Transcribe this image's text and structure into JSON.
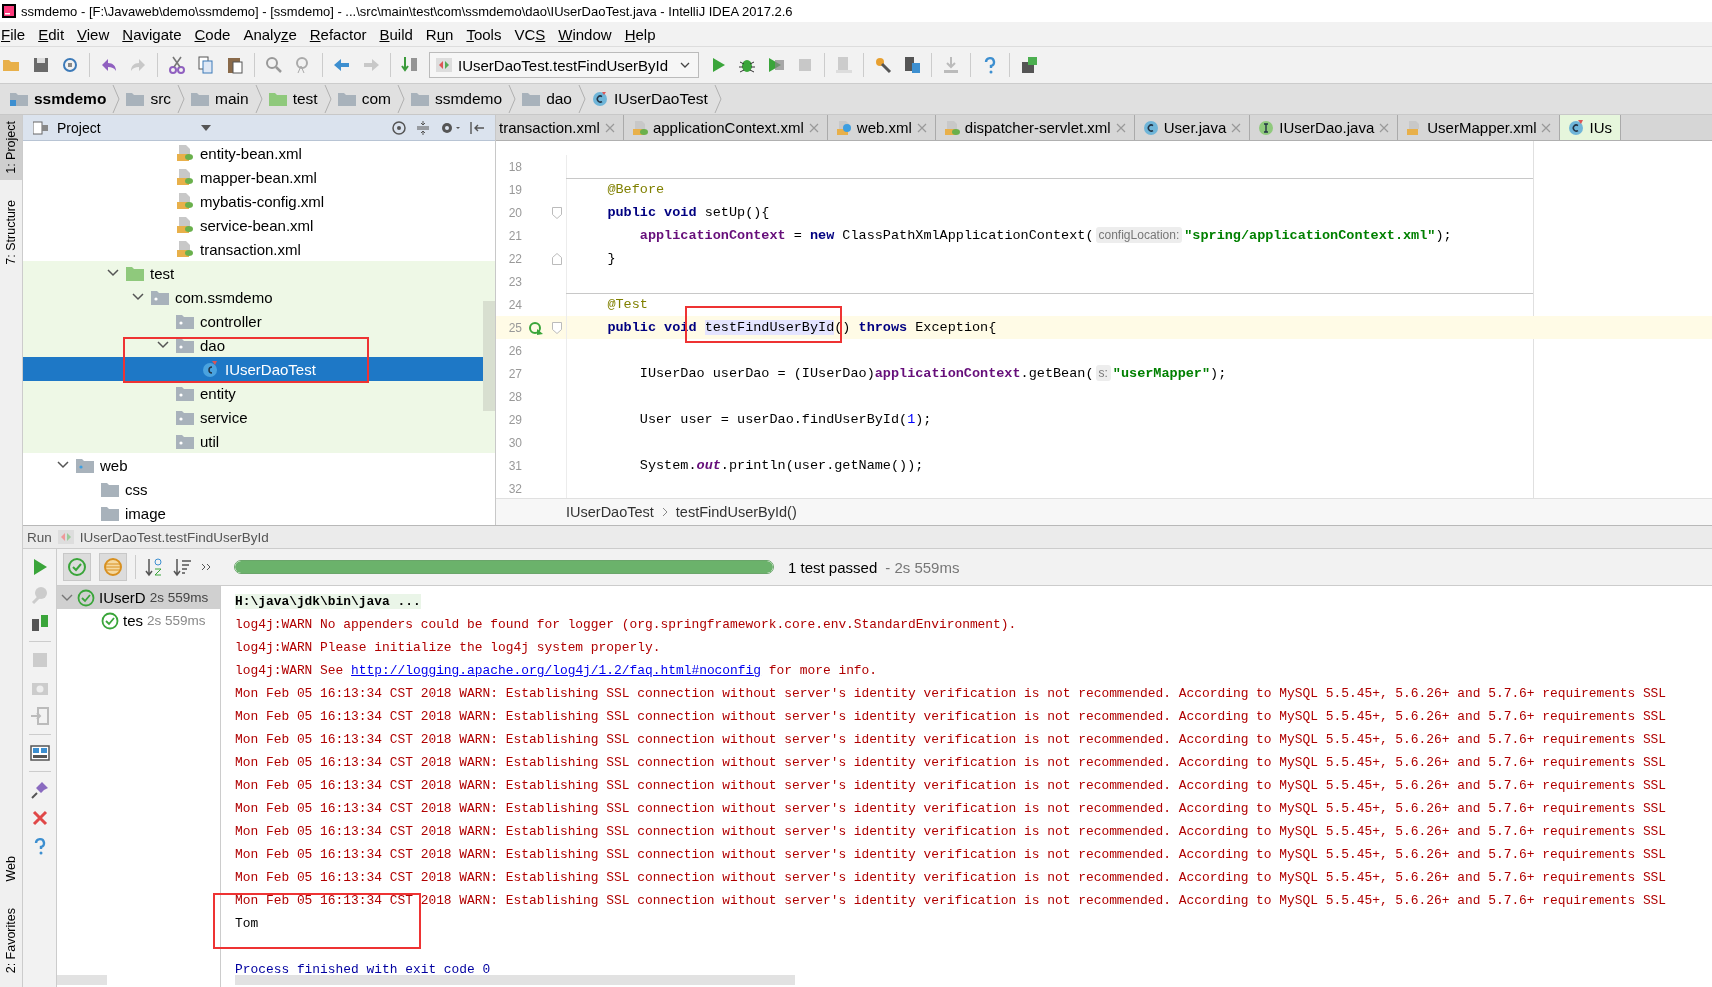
{
  "window": {
    "title": "ssmdemo - [F:\\Javaweb\\demo\\ssmdemo] - [ssmdemo] - ...\\src\\main\\test\\com\\ssmdemo\\dao\\IUserDaoTest.java - IntelliJ IDEA 2017.2.6"
  },
  "menu": [
    {
      "key": "F",
      "rest": "ile"
    },
    {
      "key": "E",
      "rest": "dit"
    },
    {
      "key": "V",
      "rest": "iew"
    },
    {
      "key": "N",
      "rest": "avigate"
    },
    {
      "key": "C",
      "rest": "ode"
    },
    {
      "lead": "Analy",
      "key": "z",
      "rest": "e"
    },
    {
      "key": "R",
      "rest": "efactor"
    },
    {
      "key": "B",
      "rest": "uild"
    },
    {
      "lead": "R",
      "key": "u",
      "rest": "n"
    },
    {
      "key": "T",
      "rest": "ools"
    },
    {
      "lead": "VC",
      "key": "S"
    },
    {
      "key": "W",
      "rest": "indow"
    },
    {
      "key": "H",
      "rest": "elp"
    }
  ],
  "toolbar": {
    "run_config": "IUserDaoTest.testFindUserById"
  },
  "breadcrumbs": [
    {
      "label": "ssmdemo",
      "kind": "module"
    },
    {
      "label": "src",
      "kind": "folder"
    },
    {
      "label": "main",
      "kind": "folder"
    },
    {
      "label": "test",
      "kind": "test_folder"
    },
    {
      "label": "com",
      "kind": "package"
    },
    {
      "label": "ssmdemo",
      "kind": "package"
    },
    {
      "label": "dao",
      "kind": "package"
    },
    {
      "label": "IUserDaoTest",
      "kind": "test_class"
    }
  ],
  "tool_strip": {
    "top": [
      {
        "label": "1: Project",
        "selected": true
      },
      {
        "label": "7: Structure",
        "selected": false
      }
    ],
    "bottom": [
      {
        "label": "Web",
        "selected": false
      },
      {
        "label": "2: Favorites",
        "selected": false
      }
    ]
  },
  "project_panel": {
    "title": "Project"
  },
  "tree": [
    {
      "children": [
        {
          "children": [
            {
              "children": [
                {
                  "children": [
                    {
                      "children": [
                        {
                          "label": "entity-bean.xml",
                          "kind": "xml",
                          "selected": false
                        },
                        {
                          "label": "mapper-bean.xml",
                          "kind": "xml",
                          "selected": false
                        },
                        {
                          "label": "mybatis-config.xml",
                          "kind": "xml",
                          "selected": false
                        },
                        {
                          "label": "service-bean.xml",
                          "kind": "xml",
                          "selected": false
                        },
                        {
                          "label": "transaction.xml",
                          "kind": "xml",
                          "selected": false
                        }
                      ]
                    }
                  ]
                },
                {
                  "label": "test",
                  "kind": "test_folder",
                  "expanded": true,
                  "selected": false,
                  "children": [
                    {
                      "label": "com.ssmdemo",
                      "kind": "package",
                      "expanded": true,
                      "selected": false,
                      "children": [
                        {
                          "label": "controller",
                          "kind": "package",
                          "selected": false
                        },
                        {
                          "label": "dao",
                          "kind": "package",
                          "expanded": true,
                          "selected": false,
                          "children": [
                            {
                              "label": "IUserDaoTest",
                              "kind": "test_class",
                              "selected": true
                            }
                          ]
                        },
                        {
                          "label": "entity",
                          "kind": "package",
                          "selected": false
                        },
                        {
                          "label": "service",
                          "kind": "package",
                          "selected": false
                        },
                        {
                          "label": "util",
                          "kind": "package",
                          "selected": false
                        }
                      ]
                    }
                  ]
                }
              ]
            }
          ]
        },
        {
          "label": "web",
          "kind": "web_folder",
          "expanded": true,
          "selected": false,
          "children": [
            {
              "label": "css",
              "kind": "folder",
              "selected": false
            },
            {
              "label": "image",
              "kind": "folder",
              "selected": false
            }
          ]
        }
      ]
    }
  ],
  "editor": {
    "tabs": [
      {
        "label": "transaction.xml",
        "kind": "spring_xml",
        "selected": false
      },
      {
        "label": "applicationContext.xml",
        "kind": "spring_xml",
        "selected": false
      },
      {
        "label": "web.xml",
        "kind": "web_xml",
        "selected": false
      },
      {
        "label": "dispatcher-servlet.xml",
        "kind": "spring_xml",
        "selected": false
      },
      {
        "label": "User.java",
        "kind": "class",
        "selected": false
      },
      {
        "label": "IUserDao.java",
        "kind": "interface",
        "selected": false
      },
      {
        "label": "UserMapper.xml",
        "kind": "xml",
        "selected": false
      },
      {
        "label": "IUs",
        "kind": "test_class",
        "selected": true
      }
    ],
    "lines": [
      {
        "number": "18",
        "current": false,
        "separator": false,
        "run": false,
        "fold_start": false,
        "fold_end": false
      },
      {
        "number": "19",
        "current": false,
        "separator": true,
        "run": false,
        "fold_start": false,
        "fold_end": false,
        "tokens": [
          {
            "text": "    @Before",
            "kind": "annotation"
          }
        ]
      },
      {
        "number": "20",
        "current": false,
        "separator": false,
        "run": false,
        "fold_start": true,
        "fold_end": false,
        "tokens": [
          {
            "text": "    public void",
            "kind": "keyword"
          },
          {
            "text": " setUp(){",
            "kind": "plain"
          }
        ]
      },
      {
        "number": "21",
        "current": false,
        "separator": false,
        "run": false,
        "fold_start": false,
        "fold_end": false,
        "tokens": [
          {
            "text": "        applicationContext",
            "kind": "field"
          },
          {
            "text": " = ",
            "kind": "plain"
          },
          {
            "text": "new",
            "kind": "keyword"
          },
          {
            "text": " ClassPathXmlApplicationContext(",
            "kind": "plain"
          },
          {
            "text": "configLocation:",
            "kind": "hint"
          },
          {
            "text": "\"spring/applicationContext.xml\"",
            "kind": "string"
          },
          {
            "text": ");",
            "kind": "plain"
          }
        ]
      },
      {
        "number": "22",
        "current": false,
        "separator": false,
        "run": false,
        "fold_start": false,
        "fold_end": true,
        "tokens": [
          {
            "text": "    }",
            "kind": "plain"
          }
        ]
      },
      {
        "number": "23",
        "current": false,
        "separator": false,
        "run": false,
        "fold_start": false,
        "fold_end": false
      },
      {
        "number": "24",
        "current": false,
        "separator": true,
        "run": false,
        "fold_start": false,
        "fold_end": false,
        "tokens": [
          {
            "text": "    @Test",
            "kind": "annotation"
          }
        ]
      },
      {
        "number": "25",
        "current": true,
        "separator": false,
        "run": true,
        "fold_start": true,
        "fold_end": false,
        "tokens": [
          {
            "text": "    public void ",
            "kind": "keyword"
          },
          {
            "text": "testFindUserById",
            "kind": "highlight"
          },
          {
            "text": "() ",
            "kind": "plain"
          },
          {
            "text": "throws",
            "kind": "keyword"
          },
          {
            "text": " Exception{",
            "kind": "plain"
          }
        ]
      },
      {
        "number": "26",
        "current": false,
        "separator": false,
        "run": false,
        "fold_start": false,
        "fold_end": false
      },
      {
        "number": "27",
        "current": false,
        "separator": false,
        "run": false,
        "fold_start": false,
        "fold_end": false,
        "tokens": [
          {
            "text": "        IUserDao userDao = (IUserDao)",
            "kind": "plain"
          },
          {
            "text": "applicationContext",
            "kind": "field"
          },
          {
            "text": ".getBean(",
            "kind": "plain"
          },
          {
            "text": "s:",
            "kind": "hint"
          },
          {
            "text": "\"userMapper\"",
            "kind": "string"
          },
          {
            "text": ");",
            "kind": "plain"
          }
        ]
      },
      {
        "number": "28",
        "current": false,
        "separator": false,
        "run": false,
        "fold_start": false,
        "fold_end": false
      },
      {
        "number": "29",
        "current": false,
        "separator": false,
        "run": false,
        "fold_start": false,
        "fold_end": false,
        "tokens": [
          {
            "text": "        User user = userDao.findUserById(",
            "kind": "plain"
          },
          {
            "text": "1",
            "kind": "number"
          },
          {
            "text": ");",
            "kind": "plain"
          }
        ]
      },
      {
        "number": "30",
        "current": false,
        "separator": false,
        "run": false,
        "fold_start": false,
        "fold_end": false
      },
      {
        "number": "31",
        "current": false,
        "separator": false,
        "run": false,
        "fold_start": false,
        "fold_end": false,
        "tokens": [
          {
            "text": "        System.",
            "kind": "plain"
          },
          {
            "text": "out",
            "kind": "static_field"
          },
          {
            "text": ".println(user.getName());",
            "kind": "plain"
          }
        ]
      },
      {
        "number": "32",
        "current": false,
        "separator": false,
        "run": false,
        "fold_start": false,
        "fold_end": false
      }
    ],
    "breadcrumb": [
      "IUserDaoTest",
      "testFindUserById()"
    ]
  },
  "run": {
    "label": "Run",
    "config": "IUserDaoTest.testFindUserById",
    "progress": {
      "level": 1
    },
    "status": "1 test passed",
    "duration": "- 2s 559ms",
    "tests": [
      {
        "label": "IUserD",
        "time": "2s 559ms",
        "passed": true,
        "selected": true,
        "children": [
          {
            "label": "tes",
            "time": "2s 559ms",
            "passed": true,
            "selected": false
          }
        ]
      }
    ],
    "console": [
      {
        "kind": "command",
        "parts": [
          {
            "text": "H:\\java\\jdk\\bin\\java ...",
            "kind": "command"
          }
        ]
      },
      {
        "kind": "text",
        "parts": [
          {
            "text": "log4j:WARN No appenders could be found for logger (org.springframework.core.env.StandardEnvironment).",
            "kind": "error"
          }
        ]
      },
      {
        "kind": "text",
        "parts": [
          {
            "text": "log4j:WARN Please initialize the log4j system properly.",
            "kind": "error"
          }
        ]
      },
      {
        "kind": "text",
        "parts": [
          {
            "text": "log4j:WARN See ",
            "kind": "error"
          },
          {
            "text": "http://logging.apache.org/log4j/1.2/faq.html#noconfig",
            "kind": "link"
          },
          {
            "text": " for more info.",
            "kind": "error"
          }
        ]
      },
      {
        "kind": "text",
        "parts": [
          {
            "text": "Mon Feb 05 16:13:34 CST 2018 WARN: Establishing SSL connection without server's identity verification is not recommended. According to MySQL 5.5.45+, 5.6.26+ and 5.7.6+ requirements SSL",
            "kind": "error"
          }
        ]
      },
      {
        "kind": "text",
        "parts": [
          {
            "text": "Mon Feb 05 16:13:34 CST 2018 WARN: Establishing SSL connection without server's identity verification is not recommended. According to MySQL 5.5.45+, 5.6.26+ and 5.7.6+ requirements SSL",
            "kind": "error"
          }
        ]
      },
      {
        "kind": "text",
        "parts": [
          {
            "text": "Mon Feb 05 16:13:34 CST 2018 WARN: Establishing SSL connection without server's identity verification is not recommended. According to MySQL 5.5.45+, 5.6.26+ and 5.7.6+ requirements SSL",
            "kind": "error"
          }
        ]
      },
      {
        "kind": "text",
        "parts": [
          {
            "text": "Mon Feb 05 16:13:34 CST 2018 WARN: Establishing SSL connection without server's identity verification is not recommended. According to MySQL 5.5.45+, 5.6.26+ and 5.7.6+ requirements SSL",
            "kind": "error"
          }
        ]
      },
      {
        "kind": "text",
        "parts": [
          {
            "text": "Mon Feb 05 16:13:34 CST 2018 WARN: Establishing SSL connection without server's identity verification is not recommended. According to MySQL 5.5.45+, 5.6.26+ and 5.7.6+ requirements SSL",
            "kind": "error"
          }
        ]
      },
      {
        "kind": "text",
        "parts": [
          {
            "text": "Mon Feb 05 16:13:34 CST 2018 WARN: Establishing SSL connection without server's identity verification is not recommended. According to MySQL 5.5.45+, 5.6.26+ and 5.7.6+ requirements SSL",
            "kind": "error"
          }
        ]
      },
      {
        "kind": "text",
        "parts": [
          {
            "text": "Mon Feb 05 16:13:34 CST 2018 WARN: Establishing SSL connection without server's identity verification is not recommended. According to MySQL 5.5.45+, 5.6.26+ and 5.7.6+ requirements SSL",
            "kind": "error"
          }
        ]
      },
      {
        "kind": "text",
        "parts": [
          {
            "text": "Mon Feb 05 16:13:34 CST 2018 WARN: Establishing SSL connection without server's identity verification is not recommended. According to MySQL 5.5.45+, 5.6.26+ and 5.7.6+ requirements SSL",
            "kind": "error"
          }
        ]
      },
      {
        "kind": "text",
        "parts": [
          {
            "text": "Mon Feb 05 16:13:34 CST 2018 WARN: Establishing SSL connection without server's identity verification is not recommended. According to MySQL 5.5.45+, 5.6.26+ and 5.7.6+ requirements SSL",
            "kind": "error"
          }
        ]
      },
      {
        "kind": "text",
        "parts": [
          {
            "text": "Mon Feb 05 16:13:34 CST 2018 WARN: Establishing SSL connection without server's identity verification is not recommended. According to MySQL 5.5.45+, 5.6.26+ and 5.7.6+ requirements SSL",
            "kind": "error"
          }
        ]
      },
      {
        "kind": "text",
        "parts": [
          {
            "text": "Tom",
            "kind": "output"
          }
        ]
      },
      {
        "kind": "exit",
        "parts": [
          {
            "text": "Process finished with exit code 0",
            "kind": "system"
          }
        ]
      }
    ]
  }
}
